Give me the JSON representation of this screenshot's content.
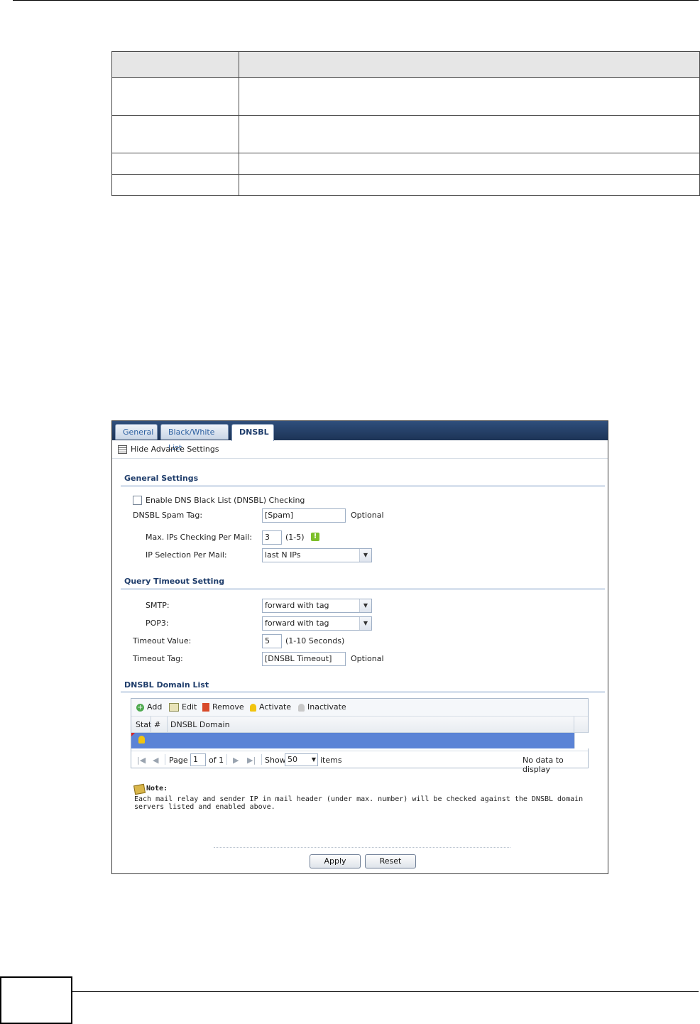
{
  "doc_table": {
    "rows": [
      {
        "c1": "",
        "c2": ""
      },
      {
        "c1": "",
        "c2": ""
      },
      {
        "c1": "",
        "c2": ""
      },
      {
        "c1": "",
        "c2": ""
      }
    ],
    "header": {
      "c1": "",
      "c2": ""
    }
  },
  "tabs": [
    {
      "label": "General"
    },
    {
      "label": "Black/White List"
    },
    {
      "label": "DNSBL",
      "active": true
    }
  ],
  "advance_toggle": "Hide Advance Settings",
  "general": {
    "title": "General Settings",
    "enable_label": "Enable DNS Black List (DNSBL) Checking",
    "spam_tag_label": "DNSBL Spam Tag:",
    "spam_tag_value": "[Spam]",
    "optional": "Optional",
    "max_ips_label": "Max. IPs Checking Per Mail:",
    "max_ips_value": "3",
    "max_ips_range": "(1-5)",
    "ip_selection_label": "IP Selection Per Mail:",
    "ip_selection_value": "last N IPs"
  },
  "query": {
    "title": "Query Timeout Setting",
    "smtp_label": "SMTP:",
    "smtp_value": "forward with tag",
    "pop3_label": "POP3:",
    "pop3_value": "forward with tag",
    "timeout_value_label": "Timeout Value:",
    "timeout_value": "5",
    "timeout_range": "(1-10 Seconds)",
    "timeout_tag_label": "Timeout Tag:",
    "timeout_tag_value": "[DNSBL Timeout]",
    "optional": "Optional"
  },
  "domain_list": {
    "title": "DNSBL Domain List",
    "toolbar": {
      "add": "Add",
      "edit": "Edit",
      "remove": "Remove",
      "activate": "Activate",
      "inactivate": "Inactivate"
    },
    "columns": [
      "Stat",
      "#",
      "DNSBL Domain"
    ],
    "pager": {
      "page_label": "Page",
      "page_value": "1",
      "of_label": "of 1",
      "show_label": "Show",
      "show_value": "50",
      "items_label": "items",
      "empty": "No data to display"
    }
  },
  "note": {
    "title": "Note:",
    "text": "Each mail relay and sender IP in mail header (under max. number) will be checked against the DNSBL domain servers listed and enabled above."
  },
  "buttons": {
    "apply": "Apply",
    "reset": "Reset"
  },
  "colors": {
    "tabbar": "#1d3456",
    "section_title": "#1f3d6b",
    "selected_row": "#5b83d6"
  }
}
